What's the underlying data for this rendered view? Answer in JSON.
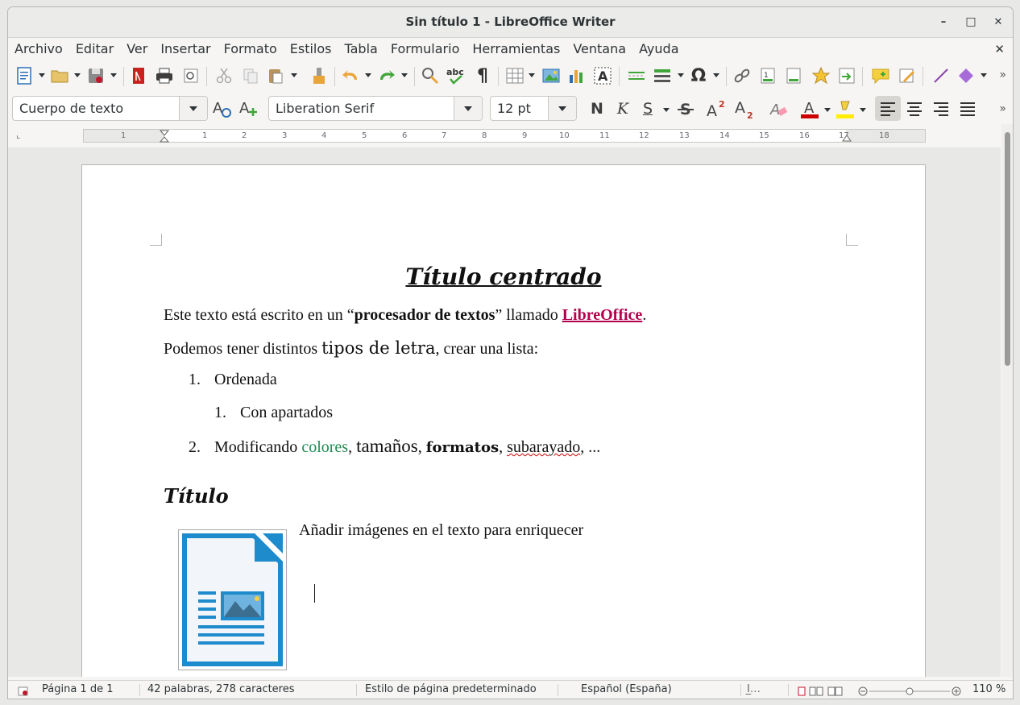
{
  "window": {
    "title": "Sin título 1 - LibreOffice Writer"
  },
  "window_controls": {
    "minimize": "–",
    "maximize": "□",
    "close": "✕"
  },
  "menubar": {
    "items": [
      "Archivo",
      "Editar",
      "Ver",
      "Insertar",
      "Formato",
      "Estilos",
      "Tabla",
      "Formulario",
      "Herramientas",
      "Ventana",
      "Ayuda"
    ],
    "close_doc": "✕"
  },
  "toolbar_standard": {
    "icons": [
      "new-document-icon",
      "open-folder-icon",
      "save-icon",
      "export-pdf-icon",
      "print-icon",
      "print-preview-icon",
      "cut-icon",
      "copy-icon",
      "paste-icon",
      "clone-formatting-icon",
      "undo-icon",
      "redo-icon",
      "find-replace-icon",
      "spelling-icon",
      "formatting-marks-icon",
      "insert-table-icon",
      "insert-image-icon",
      "insert-chart-icon",
      "insert-textbox-icon",
      "page-break-icon",
      "insert-field-icon",
      "special-character-icon",
      "hyperlink-icon",
      "footnote-icon",
      "header-footer-icon",
      "bookmark-icon",
      "cross-reference-icon",
      "comment-icon",
      "track-changes-icon",
      "line-icon",
      "basic-shapes-icon"
    ],
    "more": "»"
  },
  "toolbar_formatting": {
    "paragraph_style": "Cuerpo de texto",
    "font_name": "Liberation Serif",
    "font_size": "12 pt",
    "bold": "N",
    "italic": "K",
    "underline": "S",
    "more": "»"
  },
  "ruler": {
    "numbers": [
      "1",
      "1",
      "2",
      "3",
      "4",
      "5",
      "6",
      "7",
      "8",
      "9",
      "10",
      "11",
      "12",
      "13",
      "14",
      "15",
      "16",
      "17",
      "18"
    ]
  },
  "document": {
    "title": "Título centrado",
    "para1": {
      "a": "Este texto está escrito en un “",
      "b": "procesador de textos",
      "c": "” llamado ",
      "link": "LibreOffice",
      "d": "."
    },
    "para2": {
      "a": "Podemos tener distintos ",
      "b": "tipos de letra",
      "c": ", crear una lista:"
    },
    "list": {
      "item1_num": "1.",
      "item1": "Ordenada",
      "sub1_num": "1.",
      "sub1": "Con apartados",
      "item2_num": "2.",
      "item2_a": "Modificando ",
      "item2_colores": "colores",
      "item2_sep1": ", ",
      "item2_tamanos": "tamaños",
      "item2_sep2": ", ",
      "item2_formatos": "formatos",
      "item2_sep3": ", ",
      "item2_subrayado": "subarayado",
      "item2_end": ", ..."
    },
    "heading2": "Título",
    "image_caption": "Añadir imágenes en el texto para enriquecer"
  },
  "statusbar": {
    "page": "Página 1 de 1",
    "words": "42 palabras, 278 caracteres",
    "page_style": "Estilo de página predeterminado",
    "language": "Español (España)",
    "zoom": "110 %"
  },
  "colors": {
    "link": "#b3004d",
    "green_text": "#1e8a51",
    "font_color_bar": "#cc0000",
    "highlight_bar": "#ffee00"
  }
}
